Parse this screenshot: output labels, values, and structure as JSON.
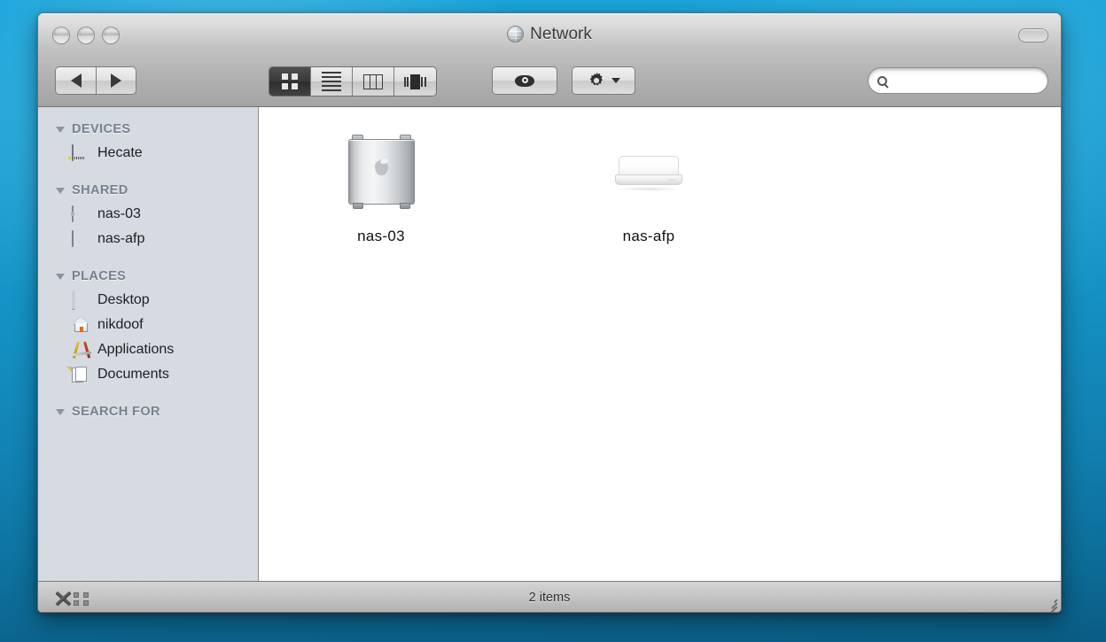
{
  "window": {
    "title": "Network",
    "title_icon": "globe-icon",
    "traffic_lights": [
      {
        "name": "close-button",
        "label": "Close"
      },
      {
        "name": "minimize-button",
        "label": "Minimize"
      },
      {
        "name": "zoom-button",
        "label": "Zoom"
      }
    ],
    "toolbar_toggle_label": ""
  },
  "toolbar": {
    "back_label": "",
    "forward_label": "",
    "view_modes": [
      {
        "name": "icon-view",
        "label": "Icon View",
        "selected": true
      },
      {
        "name": "list-view",
        "label": "List View",
        "selected": false
      },
      {
        "name": "column-view",
        "label": "Column View",
        "selected": false
      },
      {
        "name": "coverflow-view",
        "label": "Cover Flow View",
        "selected": false
      }
    ],
    "quicklook_label": "",
    "action_label": ""
  },
  "search": {
    "value": "",
    "placeholder": ""
  },
  "sidebar": {
    "groups": [
      {
        "header": "DEVICES",
        "items": [
          {
            "label": "Hecate",
            "icon": "hard-drive-icon"
          }
        ]
      },
      {
        "header": "SHARED",
        "items": [
          {
            "label": "nas-03",
            "icon": "mac-pro-icon"
          },
          {
            "label": "nas-afp",
            "icon": "network-drive-icon"
          }
        ]
      },
      {
        "header": "PLACES",
        "items": [
          {
            "label": "Desktop",
            "icon": "desktop-icon"
          },
          {
            "label": "nikdoof",
            "icon": "home-icon"
          },
          {
            "label": "Applications",
            "icon": "applications-icon"
          },
          {
            "label": "Documents",
            "icon": "documents-icon"
          }
        ]
      },
      {
        "header": "SEARCH FOR",
        "items": []
      }
    ]
  },
  "content": {
    "items": [
      {
        "label": "nas-03",
        "icon": "mac-pro-icon"
      },
      {
        "label": "nas-afp",
        "icon": "airport-base-station-icon"
      }
    ]
  },
  "statusbar": {
    "item_count": "2 items",
    "disconnect_label": "",
    "grip_label": ""
  },
  "colors": {
    "desktop": "#169fd4",
    "sidebar": "#d6dbe1",
    "sidebar_header": "#75818f",
    "toolbar": "#b2b2b2",
    "content": "#ffffff"
  }
}
